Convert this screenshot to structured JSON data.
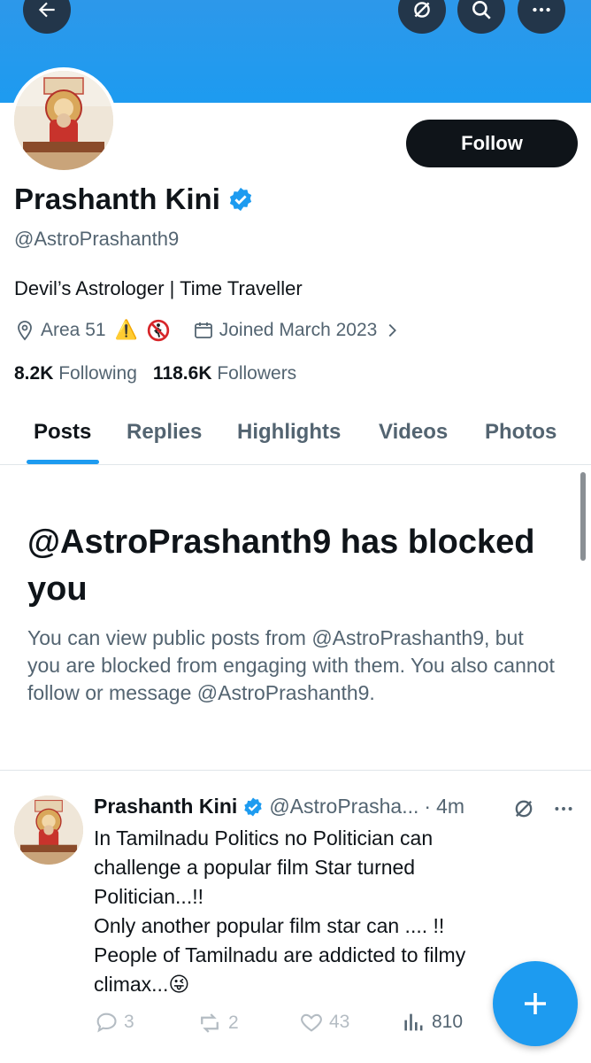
{
  "header": {
    "back_icon": "arrow-left-icon",
    "grok_icon": "grok-slash-icon",
    "search_icon": "search-icon",
    "more_icon": "more-horizontal-icon",
    "banner_color": "#1d9bf0"
  },
  "profile": {
    "name": "Prashanth Kini",
    "verified": true,
    "handle": "@AstroPrashanth9",
    "follow_label": "Follow",
    "bio": "Devil’s Astrologer | Time Traveller",
    "location": "Area 51",
    "location_emojis": "⚠️",
    "joined": "Joined March 2023",
    "following_count": "8.2K",
    "following_label": "Following",
    "followers_count": "118.6K",
    "followers_label": "Followers"
  },
  "tabs": [
    {
      "label": "Posts",
      "active": true
    },
    {
      "label": "Replies",
      "active": false
    },
    {
      "label": "Highlights",
      "active": false
    },
    {
      "label": "Videos",
      "active": false
    },
    {
      "label": "Photos",
      "active": false
    }
  ],
  "blocked": {
    "title": "@AstroPrashanth9 has blocked you",
    "message": "You can view public posts from @AstroPrashanth9, but you are blocked from engaging with them. You also cannot follow or message @AstroPrashanth9."
  },
  "post": {
    "name": "Prashanth Kini",
    "handle": "@AstroPrasha...",
    "separator": "·",
    "time": "4m",
    "lines": [
      "In Tamilnadu Politics no Politician can",
      "challenge a popular film Star turned",
      "Politician...!!",
      "Only another popular film star can .... !!",
      "People of Tamilnadu are addicted to filmy",
      "climax...😜"
    ],
    "replies": "3",
    "reposts": "2",
    "likes": "43",
    "views": "810"
  },
  "fab_icon": "plus-icon",
  "accent_color": "#1d9bf0"
}
